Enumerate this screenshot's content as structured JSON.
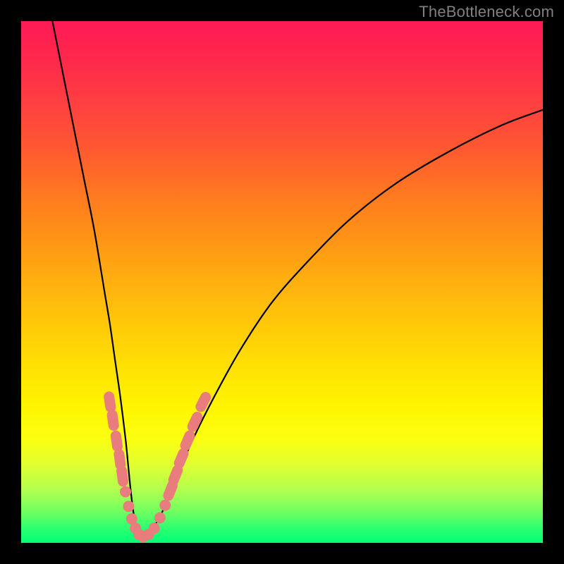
{
  "watermark": {
    "text": "TheBottleneck.com"
  },
  "colors": {
    "curve_stroke": "#000000",
    "marker_fill": "#e97d7d",
    "background_black": "#000000"
  },
  "chart_data": {
    "type": "line",
    "title": "",
    "xlabel": "",
    "ylabel": "",
    "xlim": [
      0,
      100
    ],
    "ylim": [
      0,
      100
    ],
    "grid": false,
    "legend": false,
    "series": [
      {
        "name": "bottleneck-curve",
        "x": [
          6,
          8,
          10,
          12,
          14,
          16,
          17,
          18,
          19,
          20,
          20.5,
          21,
          21.5,
          22,
          22.5,
          23,
          24,
          26,
          28,
          30,
          33,
          37,
          42,
          48,
          55,
          63,
          72,
          82,
          92,
          100
        ],
        "values": [
          100,
          90,
          80,
          70,
          60,
          48,
          42,
          35,
          28,
          20,
          15,
          10,
          6,
          3,
          1.5,
          1,
          1.5,
          4,
          8,
          13,
          20,
          28,
          37,
          46,
          54,
          62,
          69,
          75,
          80,
          83
        ]
      }
    ],
    "markers": [
      {
        "x": 17.0,
        "y": 27.0,
        "shape": "rounded"
      },
      {
        "x": 17.6,
        "y": 23.5,
        "shape": "rounded"
      },
      {
        "x": 18.3,
        "y": 19.5,
        "shape": "rounded"
      },
      {
        "x": 18.9,
        "y": 16.0,
        "shape": "rounded"
      },
      {
        "x": 19.4,
        "y": 12.8,
        "shape": "rounded"
      },
      {
        "x": 20.0,
        "y": 9.8,
        "shape": "circle"
      },
      {
        "x": 20.6,
        "y": 7.0,
        "shape": "circle"
      },
      {
        "x": 21.2,
        "y": 4.6,
        "shape": "circle"
      },
      {
        "x": 21.9,
        "y": 2.8,
        "shape": "circle"
      },
      {
        "x": 22.6,
        "y": 1.6,
        "shape": "circle"
      },
      {
        "x": 23.4,
        "y": 1.2,
        "shape": "circle"
      },
      {
        "x": 24.4,
        "y": 1.6,
        "shape": "circle"
      },
      {
        "x": 25.5,
        "y": 2.8,
        "shape": "circle"
      },
      {
        "x": 26.6,
        "y": 4.8,
        "shape": "circle"
      },
      {
        "x": 27.6,
        "y": 7.2,
        "shape": "circle"
      },
      {
        "x": 28.6,
        "y": 10.0,
        "shape": "rounded"
      },
      {
        "x": 29.6,
        "y": 13.0,
        "shape": "rounded"
      },
      {
        "x": 30.7,
        "y": 16.2,
        "shape": "rounded"
      },
      {
        "x": 31.9,
        "y": 19.6,
        "shape": "rounded"
      },
      {
        "x": 33.3,
        "y": 23.2,
        "shape": "rounded"
      },
      {
        "x": 34.9,
        "y": 27.0,
        "shape": "rounded"
      }
    ]
  }
}
